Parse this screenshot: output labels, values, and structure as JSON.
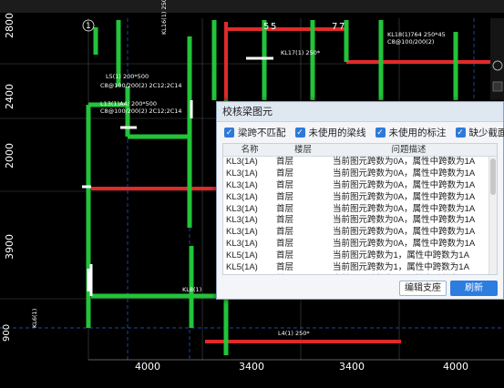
{
  "drawing": {
    "axis_labels_left": [
      "2800",
      "2400",
      "2000",
      "3900",
      "900"
    ],
    "axis_labels_bottom": [
      "4000",
      "3400",
      "3400",
      "4000"
    ],
    "grid_bubbles": [
      "1",
      "5",
      "5",
      "7",
      "7"
    ],
    "beam_labels": [
      "KL16(1) 250*",
      "KL17(1) 250*",
      "KL18(1)764  250*45",
      "C8@100/200(2)",
      "KL8(1)",
      "L4(1) 250*",
      "L5(1) 200*500",
      "C8@100/200(2) 2C12;2C14",
      "L13(1)A4/ 200*500",
      "C8@100/200(2) 2C12;2C14",
      "KL6(1)"
    ]
  },
  "dialog": {
    "title": "校核梁图元",
    "filters": [
      {
        "label": "梁跨不匹配",
        "checked": true
      },
      {
        "label": "未使用的梁线",
        "checked": true
      },
      {
        "label": "未使用的标注",
        "checked": true
      },
      {
        "label": "缺少截面",
        "checked": true
      }
    ],
    "columns": [
      "名称",
      "楼层",
      "问题描述"
    ],
    "rows": [
      {
        "name": "KL3(1A)",
        "floor": "首层",
        "issue": "当前图元跨数为0A，属性中跨数为1A"
      },
      {
        "name": "KL3(1A)",
        "floor": "首层",
        "issue": "当前图元跨数为0A，属性中跨数为1A"
      },
      {
        "name": "KL3(1A)",
        "floor": "首层",
        "issue": "当前图元跨数为0A，属性中跨数为1A"
      },
      {
        "name": "KL3(1A)",
        "floor": "首层",
        "issue": "当前图元跨数为0A，属性中跨数为1A"
      },
      {
        "name": "KL3(1A)",
        "floor": "首层",
        "issue": "当前图元跨数为0A，属性中跨数为1A"
      },
      {
        "name": "KL3(1A)",
        "floor": "首层",
        "issue": "当前图元跨数为0A，属性中跨数为1A"
      },
      {
        "name": "KL3(1A)",
        "floor": "首层",
        "issue": "当前图元跨数为0A，属性中跨数为1A"
      },
      {
        "name": "KL3(1A)",
        "floor": "首层",
        "issue": "当前图元跨数为0A，属性中跨数为1A"
      },
      {
        "name": "KL5(1A)",
        "floor": "首层",
        "issue": "当前图元跨数为1，属性中跨数为1A"
      },
      {
        "name": "KL5(1A)",
        "floor": "首层",
        "issue": "当前图元跨数为1，属性中跨数为1A"
      },
      {
        "name": "KL5(1A)",
        "floor": "首层",
        "issue": "当前图元跨数为1，属性中跨数为1A"
      },
      {
        "name": "KL5(1A)",
        "floor": "首层",
        "issue": "当前图元跨数为1，属性中跨数为1A"
      },
      {
        "name": "KL5(1A)",
        "floor": "首层",
        "issue": "当前图元跨数为1，属性中跨数为1A"
      }
    ],
    "buttons": {
      "edit": "编辑支座",
      "refresh": "刷新"
    }
  },
  "colors": {
    "beam_green": "#22c43a",
    "beam_red": "#e02a2a",
    "axis": "#ffffff",
    "accent": "#2d7ce0"
  }
}
